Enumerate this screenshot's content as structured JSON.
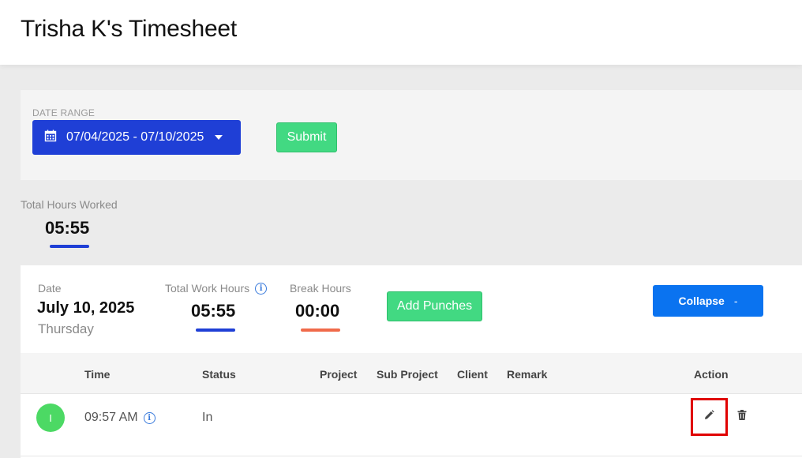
{
  "header": {
    "title": "Trisha K's Timesheet"
  },
  "filter": {
    "date_range_label": "DATE RANGE",
    "date_range_value": "07/04/2025 - 07/10/2025",
    "submit_label": "Submit"
  },
  "summary": {
    "total_hours_label": "Total Hours Worked",
    "total_hours_value": "05:55"
  },
  "day": {
    "date_label": "Date",
    "date": "July 10, 2025",
    "weekday": "Thursday",
    "total_work_hours_label": "Total Work Hours",
    "total_work_hours_value": "05:55",
    "break_hours_label": "Break Hours",
    "break_hours_value": "00:00",
    "add_punches_label": "Add Punches",
    "collapse_label": "Collapse",
    "collapse_symbol": "-"
  },
  "table": {
    "columns": [
      "Time",
      "Status",
      "Project",
      "Sub Project",
      "Client",
      "Remark",
      "Action"
    ],
    "rows": [
      {
        "avatar": "I",
        "time": "09:57 AM",
        "status": "In",
        "project": "",
        "sub_project": "",
        "client": "",
        "remark": ""
      }
    ]
  },
  "colors": {
    "primary_blue": "#1f3fd6",
    "button_blue": "#0a73f0",
    "success_green": "#42d982",
    "break_orange": "#f06a4a",
    "highlight_red": "#e00000"
  },
  "icons": {
    "date_range": "calendar-icon",
    "info": "info-icon",
    "edit": "pencil-icon",
    "delete": "trash-icon"
  }
}
